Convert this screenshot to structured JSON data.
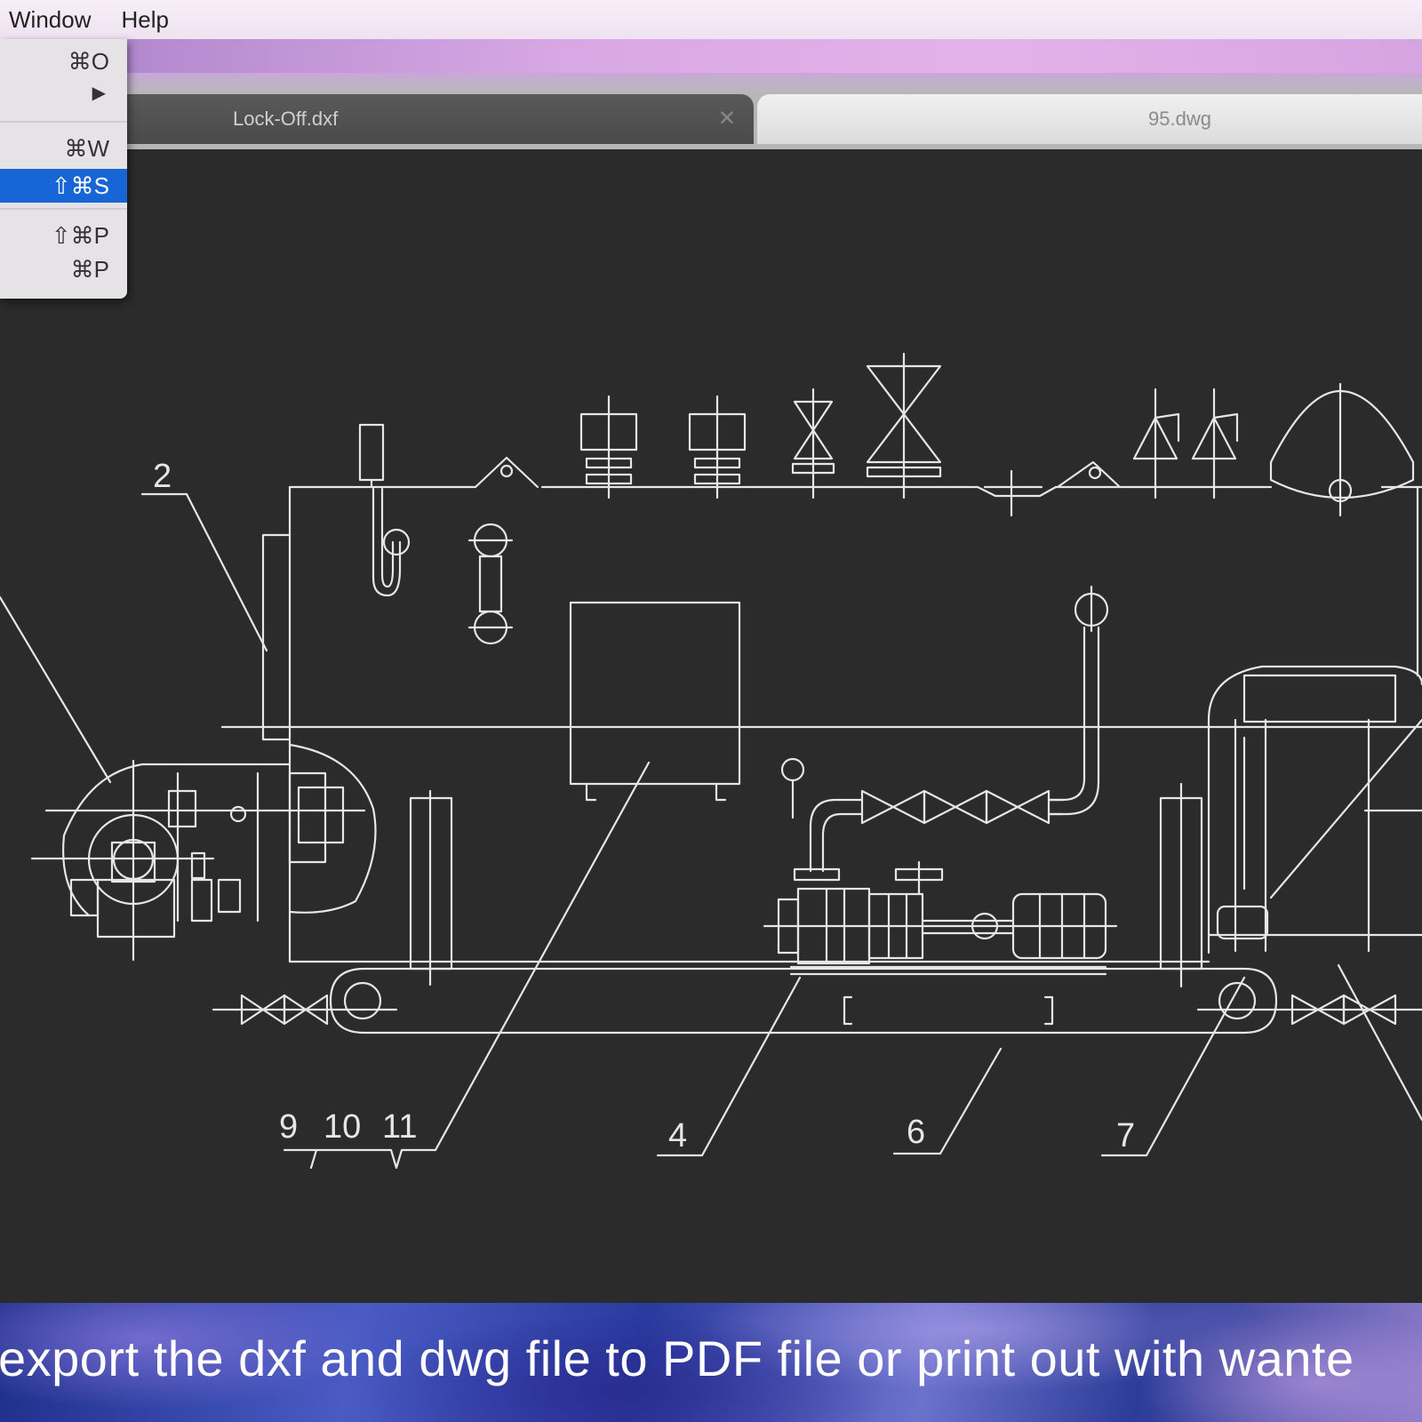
{
  "menubar": {
    "items": [
      "Window",
      "Help"
    ]
  },
  "tabs": [
    {
      "label": "Lock-Off.dxf",
      "active": true
    },
    {
      "label": "95.dwg",
      "active": false
    }
  ],
  "file_menu": {
    "shortcuts": [
      "⌘O",
      "▶",
      "⌘W",
      "⇧⌘S",
      "⇧⌘P",
      "⌘P"
    ],
    "highlighted_index": 3
  },
  "drawing": {
    "callouts": [
      "2",
      "9",
      "10",
      "11",
      "4",
      "6",
      "7"
    ]
  },
  "banner": {
    "text": "export the dxf and dwg file to PDF file or print out with wante"
  },
  "colors": {
    "highlight": "#1765d6",
    "canvas": "#2b2b2b",
    "lines": "#e6e6e6"
  }
}
